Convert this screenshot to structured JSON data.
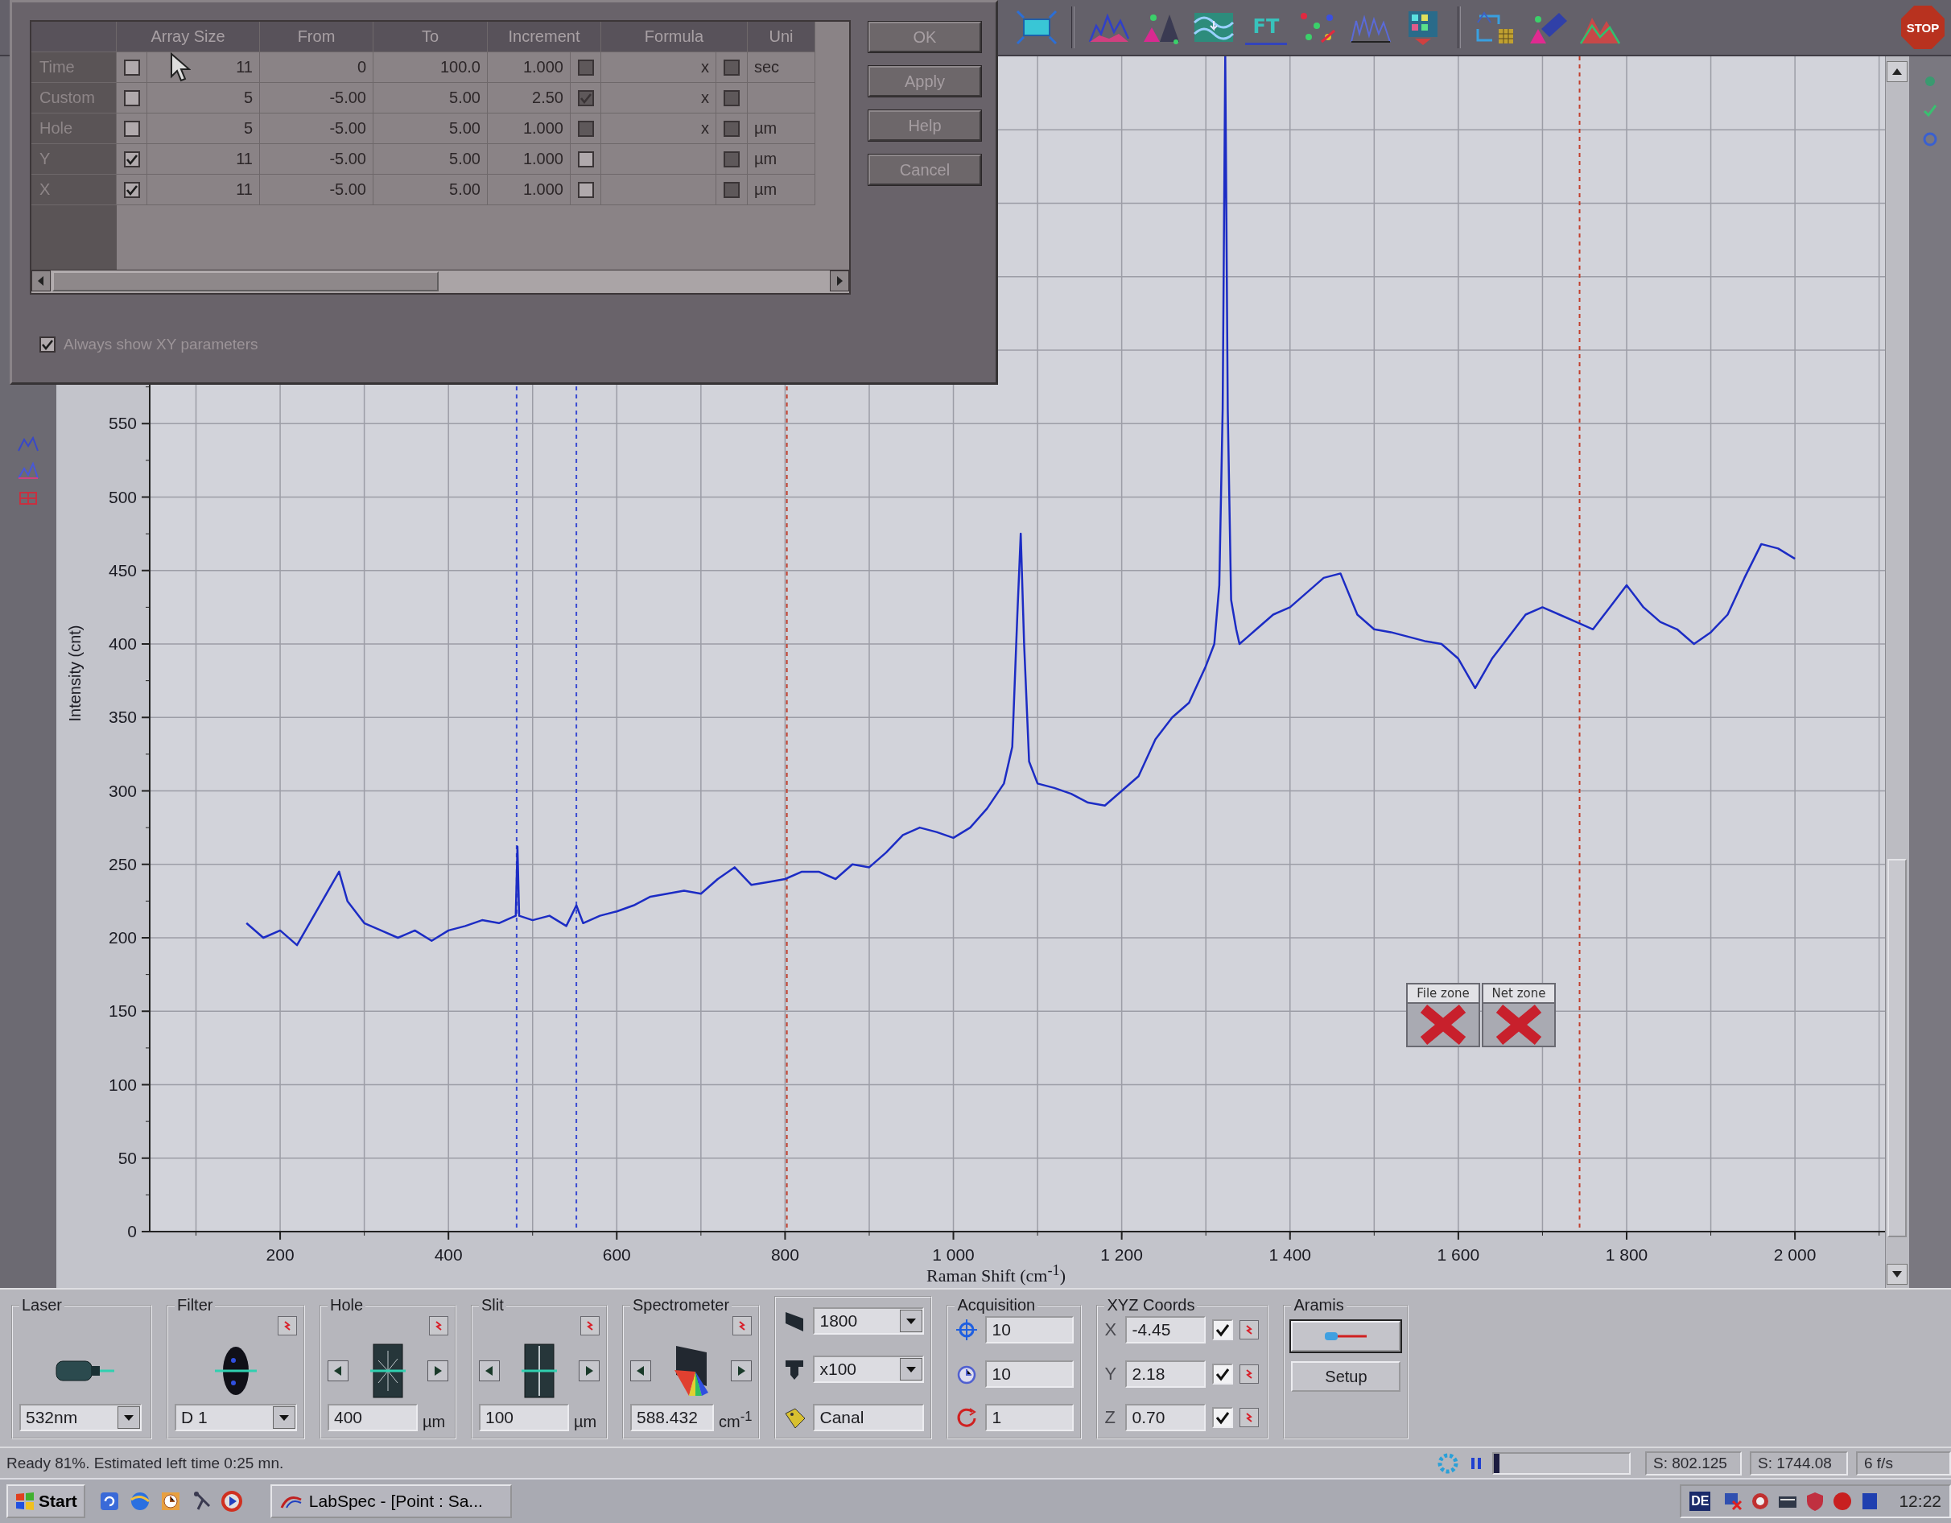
{
  "toolbar": {
    "ft_label": "FT",
    "stop_label": "STOP"
  },
  "dialog": {
    "columns": [
      "Array Size",
      "From",
      "To",
      "Increment",
      "Formula",
      "Uni"
    ],
    "rows": [
      {
        "name": "Time",
        "array": false,
        "size": "11",
        "from": "0",
        "to": "100.0",
        "increment": "1.000",
        "increment_checked": false,
        "increment_disabled": true,
        "formula": "x",
        "formula_checked": false,
        "unit": "sec"
      },
      {
        "name": "Custom",
        "array": false,
        "size": "5",
        "from": "-5.00",
        "to": "5.00",
        "increment": "2.50",
        "increment_checked": true,
        "increment_disabled": true,
        "formula": "x",
        "formula_checked": false
      },
      {
        "name": "Hole",
        "array": false,
        "size": "5",
        "from": "-5.00",
        "to": "5.00",
        "increment": "1.000",
        "increment_checked": false,
        "increment_disabled": true,
        "formula": "x",
        "formula_checked": false,
        "unit": "µm"
      },
      {
        "name": "Y",
        "array": true,
        "size": "11",
        "from": "-5.00",
        "to": "5.00",
        "increment": "1.000",
        "increment_checked": false,
        "increment_disabled": false,
        "formula_checked": false,
        "unit": "µm"
      },
      {
        "name": "X",
        "array": true,
        "size": "11",
        "from": "-5.00",
        "to": "5.00",
        "increment": "1.000",
        "increment_checked": false,
        "increment_disabled": false,
        "formula_checked": false,
        "unit": "µm"
      }
    ],
    "buttons": [
      "OK",
      "Apply",
      "Help",
      "Cancel"
    ],
    "option": {
      "label": "Always show XY parameters",
      "checked": true
    }
  },
  "chart": {
    "chart_data": {
      "type": "line",
      "xlabel": "Raman Shift (cm$^{-1}$)",
      "ylabel": "Intensity (cnt)",
      "x": [
        160,
        180,
        200,
        220,
        240,
        260,
        270,
        280,
        300,
        320,
        340,
        360,
        380,
        400,
        420,
        440,
        460,
        480,
        482,
        484,
        500,
        520,
        540,
        552,
        560,
        580,
        600,
        620,
        640,
        660,
        680,
        700,
        720,
        740,
        760,
        780,
        800,
        820,
        840,
        860,
        880,
        900,
        920,
        940,
        960,
        980,
        1000,
        1020,
        1040,
        1060,
        1070,
        1076,
        1080,
        1084,
        1090,
        1100,
        1120,
        1140,
        1160,
        1180,
        1200,
        1220,
        1240,
        1260,
        1280,
        1300,
        1310,
        1316,
        1320,
        1323,
        1326,
        1330,
        1336,
        1340,
        1350,
        1360,
        1380,
        1400,
        1420,
        1440,
        1460,
        1480,
        1500,
        1520,
        1540,
        1560,
        1580,
        1600,
        1620,
        1640,
        1660,
        1680,
        1700,
        1720,
        1740,
        1760,
        1780,
        1800,
        1820,
        1840,
        1860,
        1880,
        1900,
        1920,
        1940,
        1960,
        1980,
        2000
      ],
      "series": [
        {
          "color": "#1c2cc4",
          "values": [
            210,
            200,
            205,
            195,
            215,
            235,
            245,
            225,
            210,
            205,
            200,
            205,
            198,
            205,
            208,
            212,
            210,
            215,
            262,
            215,
            212,
            215,
            208,
            222,
            210,
            215,
            218,
            222,
            228,
            230,
            232,
            230,
            240,
            248,
            236,
            238,
            240,
            245,
            245,
            240,
            250,
            248,
            258,
            270,
            275,
            272,
            268,
            275,
            288,
            305,
            330,
            420,
            475,
            400,
            320,
            305,
            302,
            298,
            292,
            290,
            300,
            310,
            335,
            350,
            360,
            385,
            400,
            440,
            560,
            800,
            560,
            430,
            410,
            400,
            405,
            410,
            420,
            425,
            435,
            445,
            448,
            420,
            410,
            408,
            405,
            402,
            400,
            390,
            370,
            390,
            405,
            420,
            425,
            420,
            415,
            410,
            425,
            440,
            425,
            415,
            410,
            400,
            408,
            420,
            445,
            468,
            465,
            458
          ]
        }
      ],
      "xlim": [
        45,
        2107
      ],
      "ylim": [
        0,
        800
      ],
      "xticks": [
        200,
        400,
        600,
        800,
        {
          "value": 1000,
          "label": "1 000"
        },
        {
          "value": 1200,
          "label": "1 200"
        },
        {
          "value": 1400,
          "label": "1 400"
        },
        {
          "value": 1600,
          "label": "1 600"
        },
        {
          "value": 1800,
          "label": "1 800"
        },
        {
          "value": 2000,
          "label": "2 000"
        }
      ],
      "yticks": [
        0,
        50,
        100,
        150,
        200,
        250,
        300,
        350,
        400,
        450,
        500,
        550
      ],
      "grid": true,
      "ref_lines": [
        {
          "axis": "x",
          "value": 481,
          "color": "#3a4ad2"
        },
        {
          "axis": "x",
          "value": 552,
          "color": "#3a4ad2"
        },
        {
          "axis": "x",
          "value": 802.125,
          "color": "#c2402e"
        },
        {
          "axis": "x",
          "value": 1744.08,
          "color": "#c2402e"
        }
      ]
    },
    "zones": [
      {
        "label": "File zone"
      },
      {
        "label": "Net zone"
      }
    ]
  },
  "panel": {
    "groups": [
      {
        "kind": "laser",
        "title": "Laser",
        "value": "532nm"
      },
      {
        "kind": "filter",
        "title": "Filter",
        "value": "D 1"
      },
      {
        "kind": "hole",
        "title": "Hole",
        "value": "400",
        "unit": "µm"
      },
      {
        "kind": "slit",
        "title": "Slit",
        "value": "100",
        "unit": "µm"
      },
      {
        "kind": "spectrometer",
        "title": "Spectrometer",
        "value": "588.432",
        "unit": "cm$^{-1}$"
      },
      {
        "kind": "optics",
        "rows": [
          {
            "kind": "dropdown",
            "value": "1800"
          },
          {
            "kind": "dropdown",
            "value": "x100"
          },
          {
            "kind": "field",
            "value": "Canal"
          }
        ]
      },
      {
        "kind": "acquisition",
        "title": "Acquisition",
        "fields": [
          "10",
          "10",
          "1"
        ]
      },
      {
        "kind": "coords",
        "title": "XYZ Coords",
        "axes": [
          {
            "label": "X",
            "value": "-4.45",
            "checked": true
          },
          {
            "label": "Y",
            "value": "2.18",
            "checked": true
          },
          {
            "label": "Z",
            "value": "0.70",
            "checked": true
          }
        ]
      },
      {
        "kind": "aramis",
        "title": "Aramis",
        "button": "Setup"
      }
    ]
  },
  "status": {
    "message": "Ready 81%. Estimated left time 0:25 mn.",
    "progress": {
      "level": 0.04
    },
    "readouts": [
      "S: 802.125",
      "S: 1744.08",
      "6 f/s"
    ]
  },
  "taskbar": {
    "start": "Start",
    "tasks": [
      {
        "label": "LabSpec - [Point : Sa...",
        "selected": false
      }
    ],
    "tray": {
      "language": "DE",
      "clock": "12:22"
    }
  }
}
